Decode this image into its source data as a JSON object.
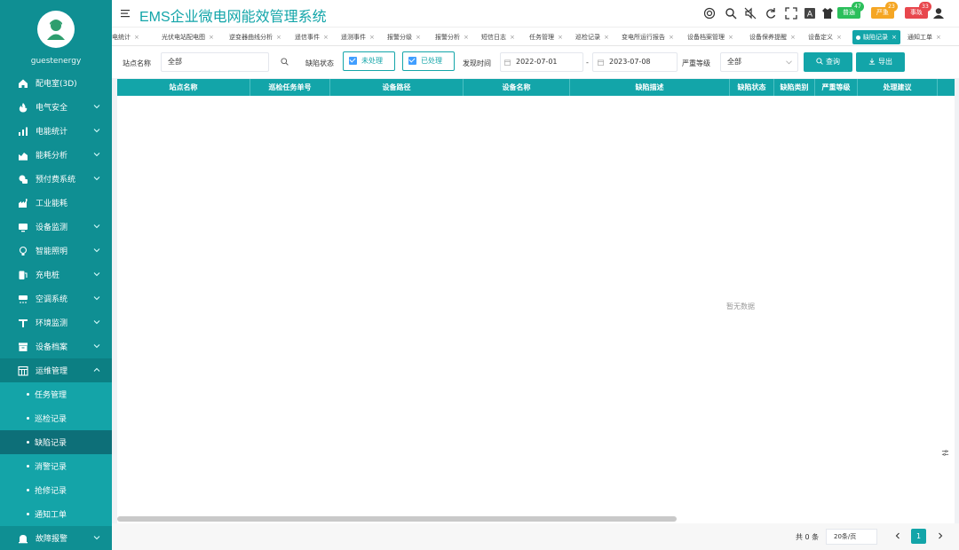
{
  "app": {
    "title": "EMS企业微电网能效管理系统",
    "username": "guestenergy",
    "colors": {
      "primary": "#13a5a9",
      "sidebar": "#0f8f93",
      "badge_green": "#2bbf5b",
      "badge_orange": "#f5a623",
      "badge_red": "#e8474d"
    }
  },
  "header": {
    "badges": [
      {
        "label": "普通",
        "count": "47"
      },
      {
        "label": "严重",
        "count": "23"
      },
      {
        "label": "事故",
        "count": "33"
      }
    ]
  },
  "sidebar": {
    "items": [
      {
        "label": "配电室(3D)",
        "icon": "home-icon",
        "has_arrow": false
      },
      {
        "label": "电气安全",
        "icon": "fire-icon",
        "has_arrow": true
      },
      {
        "label": "电能统计",
        "icon": "bar-chart-icon",
        "has_arrow": true
      },
      {
        "label": "能耗分析",
        "icon": "area-chart-icon",
        "has_arrow": true
      },
      {
        "label": "预付费系统",
        "icon": "prepay-icon",
        "has_arrow": true
      },
      {
        "label": "工业能耗",
        "icon": "factory-icon",
        "has_arrow": false
      },
      {
        "label": "设备监测",
        "icon": "monitor-icon",
        "has_arrow": true
      },
      {
        "label": "智能照明",
        "icon": "bulb-icon",
        "has_arrow": true
      },
      {
        "label": "充电桩",
        "icon": "charger-icon",
        "has_arrow": true
      },
      {
        "label": "空调系统",
        "icon": "aircon-icon",
        "has_arrow": true
      },
      {
        "label": "环境监测",
        "icon": "env-icon",
        "has_arrow": true
      },
      {
        "label": "设备档案",
        "icon": "archive-icon",
        "has_arrow": true
      },
      {
        "label": "运维管理",
        "icon": "ops-icon",
        "has_arrow": true
      }
    ],
    "sub_items": [
      "任务管理",
      "巡检记录",
      "缺陷记录",
      "消警记录",
      "抢修记录",
      "通知工单"
    ],
    "active_sub": "缺陷记录",
    "last_item": {
      "label": "故障报警",
      "icon": "alarm-icon"
    }
  },
  "tabs": [
    {
      "label": "电统计",
      "active": false
    },
    {
      "label": "光伏电站配电图",
      "active": false
    },
    {
      "label": "逆变器曲线分析",
      "active": false
    },
    {
      "label": "遥信事件",
      "active": false
    },
    {
      "label": "遥测事件",
      "active": false
    },
    {
      "label": "报警分级",
      "active": false
    },
    {
      "label": "报警分析",
      "active": false
    },
    {
      "label": "短信日志",
      "active": false
    },
    {
      "label": "任务管理",
      "active": false
    },
    {
      "label": "巡检记录",
      "active": false
    },
    {
      "label": "变电所运行报告",
      "active": false
    },
    {
      "label": "设备档案管理",
      "active": false
    },
    {
      "label": "设备保养提醒",
      "active": false
    },
    {
      "label": "设备定义",
      "active": false
    },
    {
      "label": "缺陷记录",
      "active": true
    },
    {
      "label": "通知工单",
      "active": false
    }
  ],
  "filters": {
    "station_label": "站点名称",
    "station_value": "全部",
    "defect_status_label": "缺陷状态",
    "status_unprocessed": "未处理",
    "status_processed": "已处理",
    "found_time_label": "发现时间",
    "date_from": "2022-07-01",
    "date_sep": "-",
    "date_to": "2023-07-08",
    "severity_label": "严重等级",
    "severity_value": "全部",
    "query_button": "查询",
    "export_button": "导出"
  },
  "table": {
    "columns": [
      "站点名称",
      "巡检任务单号",
      "设备路径",
      "设备名称",
      "缺陷描述",
      "缺陷状态",
      "缺陷类别",
      "严重等级",
      "处理建议"
    ],
    "empty_text": "暂无数据"
  },
  "pager": {
    "total": "共 0 条",
    "page_size": "20条/页",
    "current_page": "1"
  }
}
